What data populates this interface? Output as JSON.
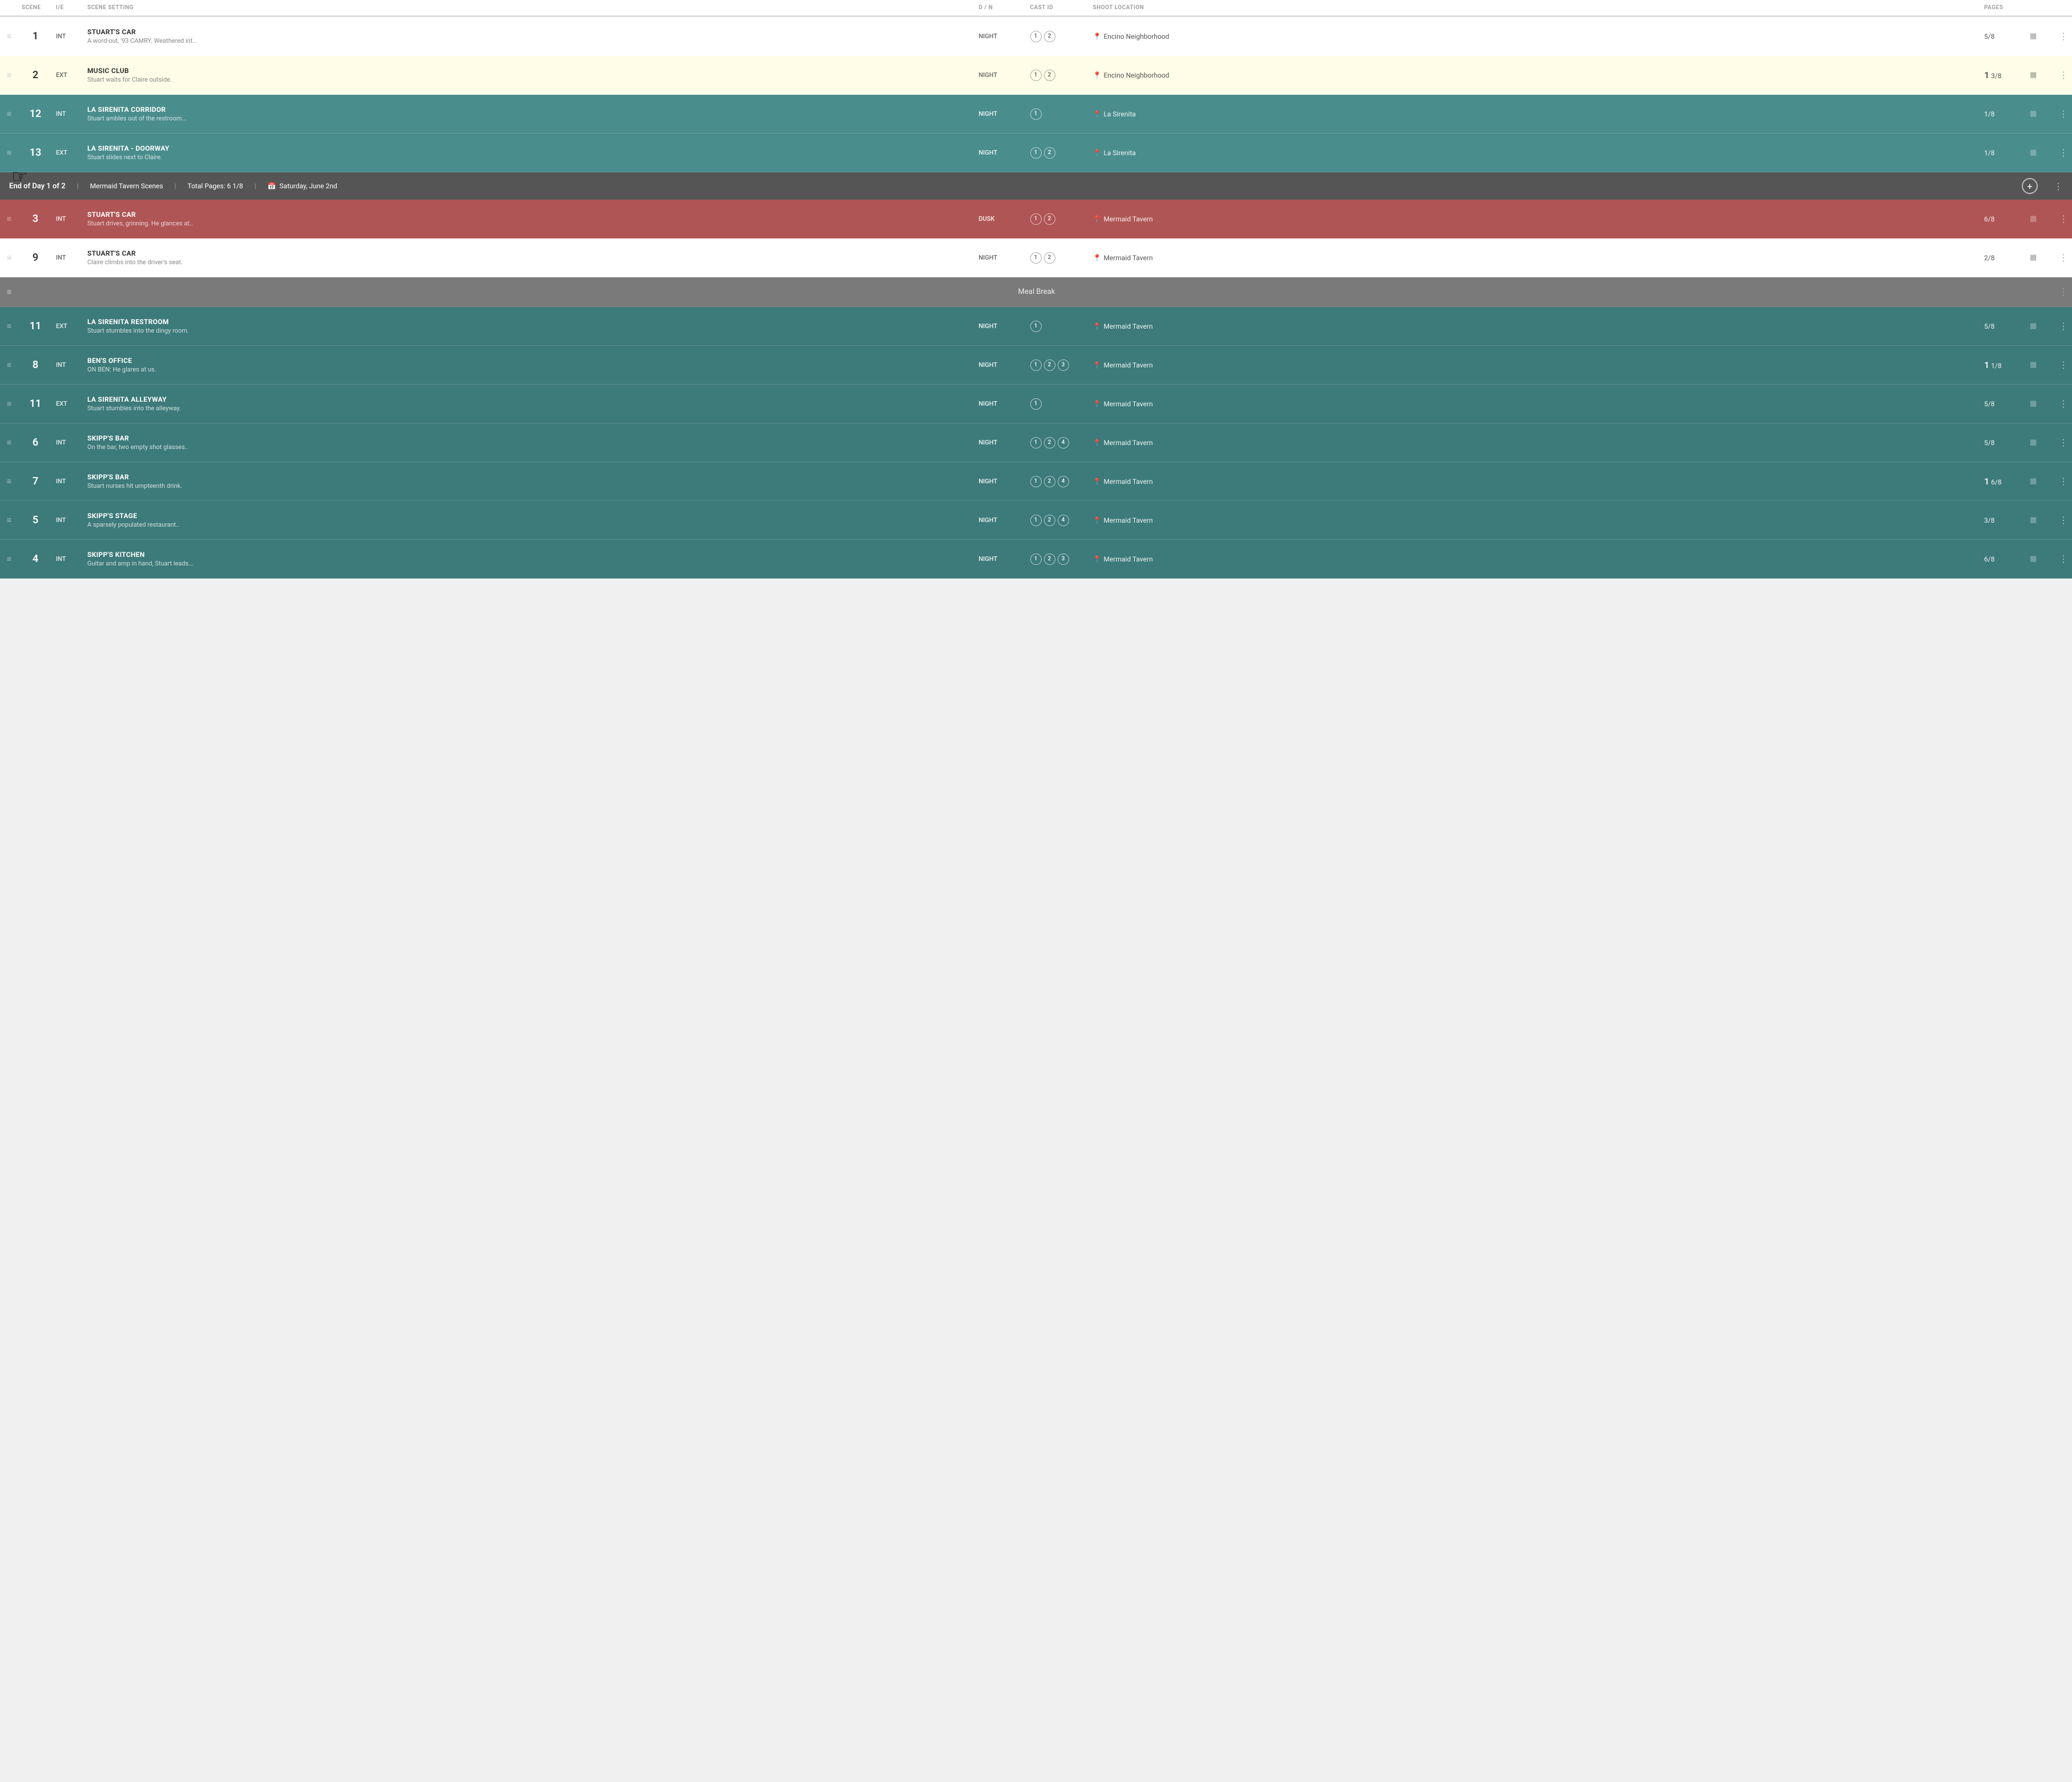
{
  "header": {
    "columns": [
      "",
      "SCENE",
      "I/E",
      "SCENE SETTING",
      "D / N",
      "CAST ID",
      "SHOOT LOCATION",
      "PAGES",
      "",
      ""
    ]
  },
  "rows": [
    {
      "id": "row-1",
      "type": "scene",
      "colorClass": "row-white",
      "scene": "1",
      "ie": "INT",
      "title": "STUART'S CAR",
      "desc": "A word-out, '93 CAMRY. Weathered int...",
      "dn": "NIGHT",
      "castIds": [
        "1",
        "2"
      ],
      "location": "Encino Neighborhood",
      "pages": "5/8",
      "pagesMain": null
    },
    {
      "id": "row-2",
      "type": "scene",
      "colorClass": "row-yellow",
      "scene": "2",
      "ie": "EXT",
      "title": "MUSIC CLUB",
      "desc": "Stuart waits for Claire outside.",
      "dn": "NIGHT",
      "castIds": [
        "1",
        "2"
      ],
      "location": "Encino Neighborhood",
      "pages": "3/8",
      "pagesMain": "1"
    },
    {
      "id": "row-12",
      "type": "scene",
      "colorClass": "row-teal",
      "scene": "12",
      "ie": "INT",
      "title": "LA SIRENITA CORRIDOR",
      "desc": "Stuart ambles out of the restroom...",
      "dn": "NIGHT",
      "castIds": [
        "1"
      ],
      "location": "La Sirenita",
      "pages": "1/8",
      "pagesMain": null
    },
    {
      "id": "row-13",
      "type": "scene",
      "colorClass": "row-teal",
      "scene": "13",
      "ie": "EXT",
      "title": "LA SIRENITA - DOORWAY",
      "desc": "Stuart slides next to Claire.",
      "dn": "NIGHT",
      "castIds": [
        "1",
        "2"
      ],
      "location": "La Sirenita",
      "pages": "1/8",
      "pagesMain": null
    }
  ],
  "dayBanner": {
    "dayText": "End of Day 1 of 2",
    "scenesText": "Mermaid Tavern Scenes",
    "totalPagesLabel": "Total Pages:",
    "totalPages": "6 1/8",
    "dateIcon": "📅",
    "date": "Saturday, June 2nd",
    "addLabel": "+",
    "moreLabel": "⋮"
  },
  "mermaidRows": [
    {
      "id": "row-3",
      "type": "scene",
      "colorClass": "row-red",
      "scene": "3",
      "ie": "INT",
      "title": "STUART'S CAR",
      "desc": "Stuart drives, grinning. He glances at..",
      "dn": "DUSK",
      "castIds": [
        "1",
        "2"
      ],
      "location": "Mermaid Tavern",
      "pages": "6/8",
      "pagesMain": null
    },
    {
      "id": "row-9",
      "type": "scene",
      "colorClass": "row-white",
      "scene": "9",
      "ie": "INT",
      "title": "STUART'S CAR",
      "desc": "Claire climbs into the driver's seat.",
      "dn": "NIGHT",
      "castIds": [
        "1",
        "2"
      ],
      "location": "Mermaid Tavern",
      "pages": "2/8",
      "pagesMain": null
    },
    {
      "id": "meal-break",
      "type": "meal",
      "label": "Meal Break"
    },
    {
      "id": "row-11",
      "type": "scene",
      "colorClass": "row-dark-teal",
      "scene": "11",
      "ie": "EXT",
      "title": "LA SIRENITA RESTROOM",
      "desc": "Stuart stumbles into the dingy room.",
      "dn": "NIGHT",
      "castIds": [
        "1"
      ],
      "location": "Mermaid Tavern",
      "pages": "5/8",
      "pagesMain": null
    },
    {
      "id": "row-8",
      "type": "scene",
      "colorClass": "row-dark-teal",
      "scene": "8",
      "ie": "INT",
      "title": "BEN'S OFFICE",
      "desc": "ON BEN: He glares at us.",
      "dn": "NIGHT",
      "castIds": [
        "1",
        "2",
        "3"
      ],
      "location": "Mermaid Tavern",
      "pages": "1/8",
      "pagesMain": "1"
    },
    {
      "id": "row-11b",
      "type": "scene",
      "colorClass": "row-dark-teal",
      "scene": "11",
      "ie": "EXT",
      "title": "LA SIRENITA ALLEYWAY",
      "desc": "Stuart stumbles into the alleyway.",
      "dn": "NIGHT",
      "castIds": [
        "1"
      ],
      "location": "Mermaid Tavern",
      "pages": "5/8",
      "pagesMain": null
    },
    {
      "id": "row-6",
      "type": "scene",
      "colorClass": "row-dark-teal",
      "scene": "6",
      "ie": "INT",
      "title": "SKIPP'S BAR",
      "desc": "On the bar, two empty shot glasses..",
      "dn": "NIGHT",
      "castIds": [
        "1",
        "2",
        "4"
      ],
      "location": "Mermaid Tavern",
      "pages": "5/8",
      "pagesMain": null
    },
    {
      "id": "row-7",
      "type": "scene",
      "colorClass": "row-dark-teal",
      "scene": "7",
      "ie": "INT",
      "title": "SKIPP'S BAR",
      "desc": "Stuart nurses hit umpteenth drink.",
      "dn": "NIGHT",
      "castIds": [
        "1",
        "2",
        "4"
      ],
      "location": "Mermaid Tavern",
      "pages": "6/8",
      "pagesMain": "1"
    },
    {
      "id": "row-5",
      "type": "scene",
      "colorClass": "row-dark-teal",
      "scene": "5",
      "ie": "INT",
      "title": "SKIPP'S STAGE",
      "desc": "A sparsely populated restaurant..",
      "dn": "NIGHT",
      "castIds": [
        "1",
        "2",
        "4"
      ],
      "location": "Mermaid Tavern",
      "pages": "3/8",
      "pagesMain": null
    },
    {
      "id": "row-4",
      "type": "scene",
      "colorClass": "row-dark-teal",
      "scene": "4",
      "ie": "INT",
      "title": "SKIPP'S KITCHEN",
      "desc": "Guitar and amp in hand, Stuart leads...",
      "dn": "NIGHT",
      "castIds": [
        "1",
        "2",
        "3"
      ],
      "location": "Mermaid Tavern",
      "pages": "6/8",
      "pagesMain": null
    }
  ],
  "icons": {
    "drag": "≡",
    "more": "⋮",
    "pin": "📍",
    "calendar": "📅",
    "storyboard": "▦"
  }
}
